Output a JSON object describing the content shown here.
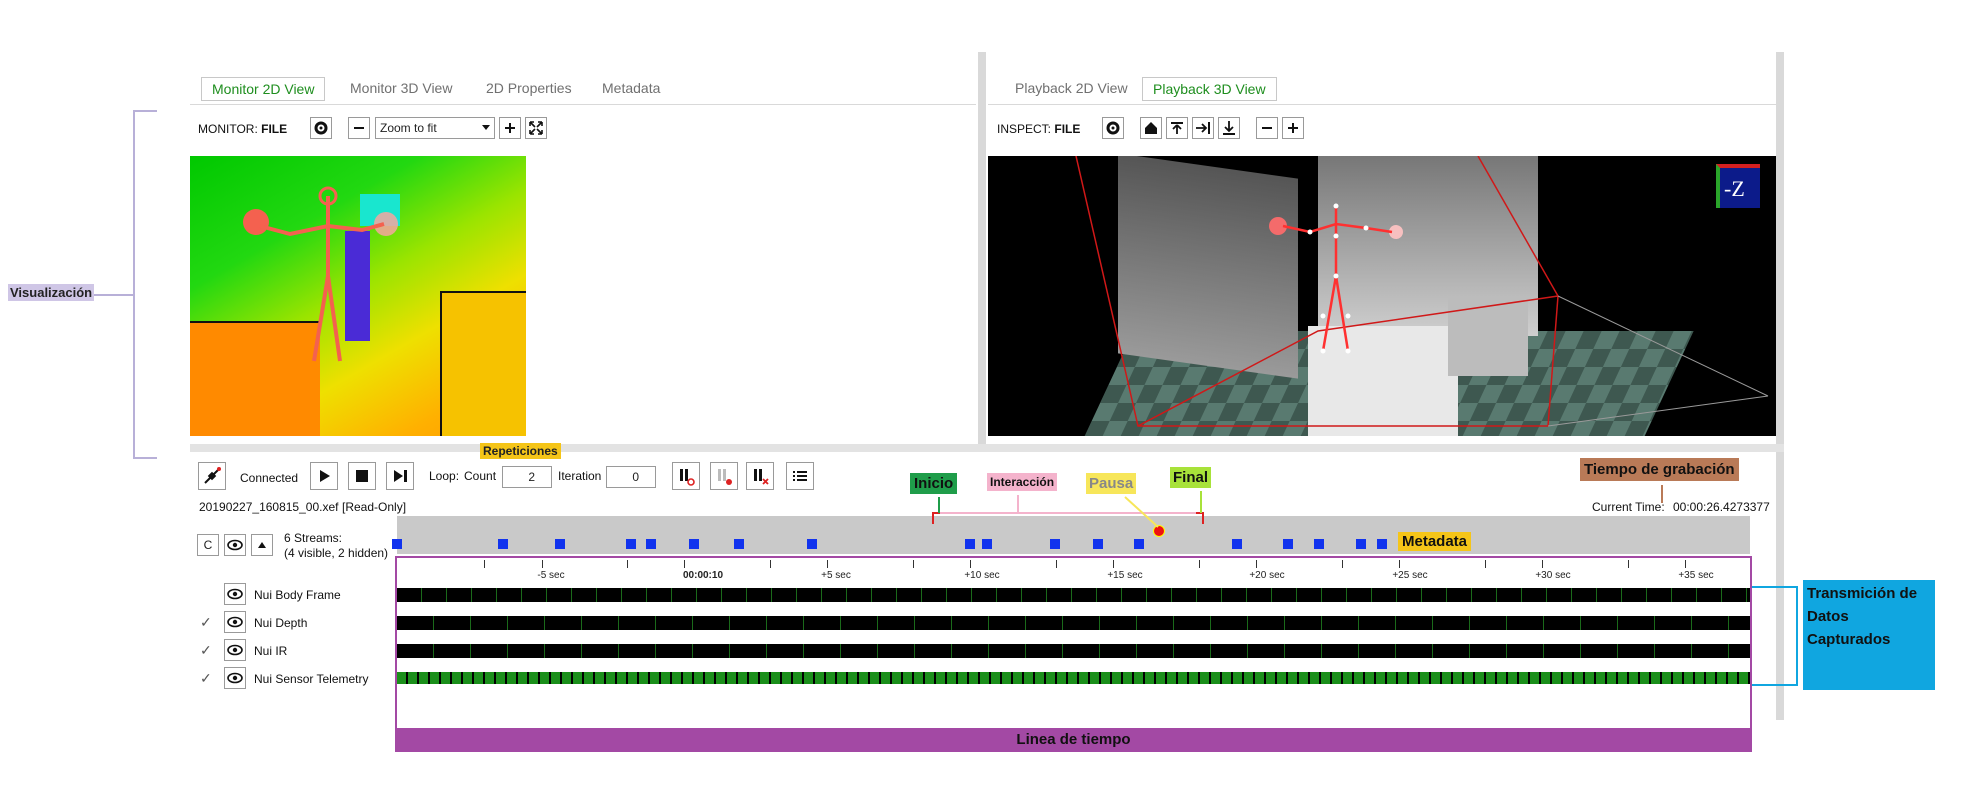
{
  "monitor": {
    "tabs": [
      {
        "label": "Monitor 2D View"
      },
      {
        "label": "Monitor 3D View"
      },
      {
        "label": "2D Properties"
      },
      {
        "label": "Metadata"
      }
    ],
    "prefix": "MONITOR:",
    "source": "FILE",
    "zoom_value": "Zoom to fit"
  },
  "inspect": {
    "tabs": [
      {
        "label": "Playback 2D View"
      },
      {
        "label": "Playback 3D View"
      }
    ],
    "prefix": "INSPECT:",
    "source": "FILE",
    "axis_cube_label": "-Z"
  },
  "transport": {
    "connected_label": "Connected",
    "loop_label": "Loop:",
    "count_label": "Count",
    "count_value": "2",
    "iteration_label": "Iteration",
    "iteration_value": "0",
    "file_name": "20190227_160815_00.xef",
    "read_only": "[Read-Only]",
    "current_time_label": "Current Time:",
    "current_time_value": "00:00:26.4273377"
  },
  "streams": {
    "c_button": "C",
    "summary_line1": "6 Streams:",
    "summary_line2": "(4 visible, 2 hidden)",
    "items": [
      {
        "name": "Nui Body Frame",
        "checked": false
      },
      {
        "name": "Nui Depth",
        "checked": true
      },
      {
        "name": "Nui IR",
        "checked": true
      },
      {
        "name": "Nui Sensor Telemetry",
        "checked": true
      }
    ]
  },
  "ruler": {
    "labels": [
      "-5 sec",
      "00:00:10",
      "+5 sec",
      "+10 sec",
      "+15 sec",
      "+20 sec",
      "+25 sec",
      "+30 sec",
      "+35 sec"
    ]
  },
  "annotations": {
    "visualizacion": "Visualización",
    "repeticiones": "Repeticiones",
    "inicio": "Inicio",
    "interaccion": "Interacción",
    "pausa": "Pausa",
    "final": "Final",
    "tiempo": "Tiempo de grabación",
    "metadata": "Metadata",
    "transmision": "Transmición de Datos Capturados",
    "linea": "Linea de tiempo"
  },
  "colors": {
    "active_tab": "#1e8e1e",
    "marker": "#1133ee",
    "visualizacion_bg": "#cfc6e6",
    "repeticiones_bg": "#f5c518",
    "inicio_bg": "#1f9d4a",
    "interaccion_bg": "#f4b3cc",
    "pausa_bg": "#f7e65a",
    "final_bg": "#a8e23a",
    "tiempo_bg": "#b97a57",
    "metadata_bg": "#f5c518",
    "transmision_bg": "#10a6e0",
    "linea_bg": "#a349a4",
    "telemetry_track": "#1a8f1a"
  },
  "icons": [
    "settings-icon",
    "minus-icon",
    "plus-icon",
    "fit-icon",
    "home-icon",
    "first-icon",
    "next-icon",
    "last-icon",
    "play-icon",
    "stop-icon",
    "step-icon",
    "plugin-icon",
    "pause-point-icon",
    "list-icon",
    "eye-icon",
    "check-icon"
  ]
}
